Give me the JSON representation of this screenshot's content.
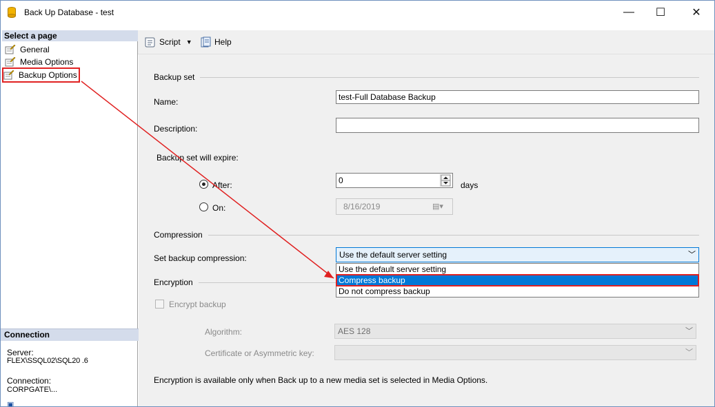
{
  "window": {
    "title": "Back Up Database - test",
    "minimize_glyph": "—",
    "maximize_glyph": "☐",
    "close_glyph": "✕"
  },
  "sidebar": {
    "header": "Select a page",
    "items": [
      {
        "label": "General"
      },
      {
        "label": "Media Options"
      },
      {
        "label": "Backup Options"
      }
    ]
  },
  "connection": {
    "header": "Connection",
    "server_label": "Server:",
    "server_value": "FLEX\\SSQL02\\SQL20 .6",
    "connection_label": "Connection:",
    "connection_value": "CORPGATE\\..."
  },
  "toolbar": {
    "script_label": "Script",
    "help_label": "Help"
  },
  "backup_set": {
    "group_label": "Backup set",
    "name_label": "Name:",
    "name_value": "test-Full Database Backup",
    "description_label": "Description:",
    "description_value": "",
    "expire_label": "Backup set will expire:",
    "after_label": "After:",
    "after_value": "0",
    "days_label": "days",
    "on_label": "On:",
    "on_value": "8/16/2019"
  },
  "compression": {
    "group_label": "Compression",
    "set_label": "Set backup compression:",
    "selected": "Use the default server setting",
    "options": [
      "Use the default server setting",
      "Compress backup",
      "Do not compress backup"
    ]
  },
  "encryption": {
    "group_label": "Encryption",
    "checkbox_label": "Encrypt backup",
    "algorithm_label": "Algorithm:",
    "algorithm_value": "AES 128",
    "certificate_label": "Certificate or Asymmetric key:",
    "certificate_value": "",
    "note": "Encryption is available only when Back up to a new media set is selected in Media Options."
  },
  "colors": {
    "highlight": "#0078d7",
    "annotation": "#e02020",
    "panel_header": "#d4dceb"
  }
}
